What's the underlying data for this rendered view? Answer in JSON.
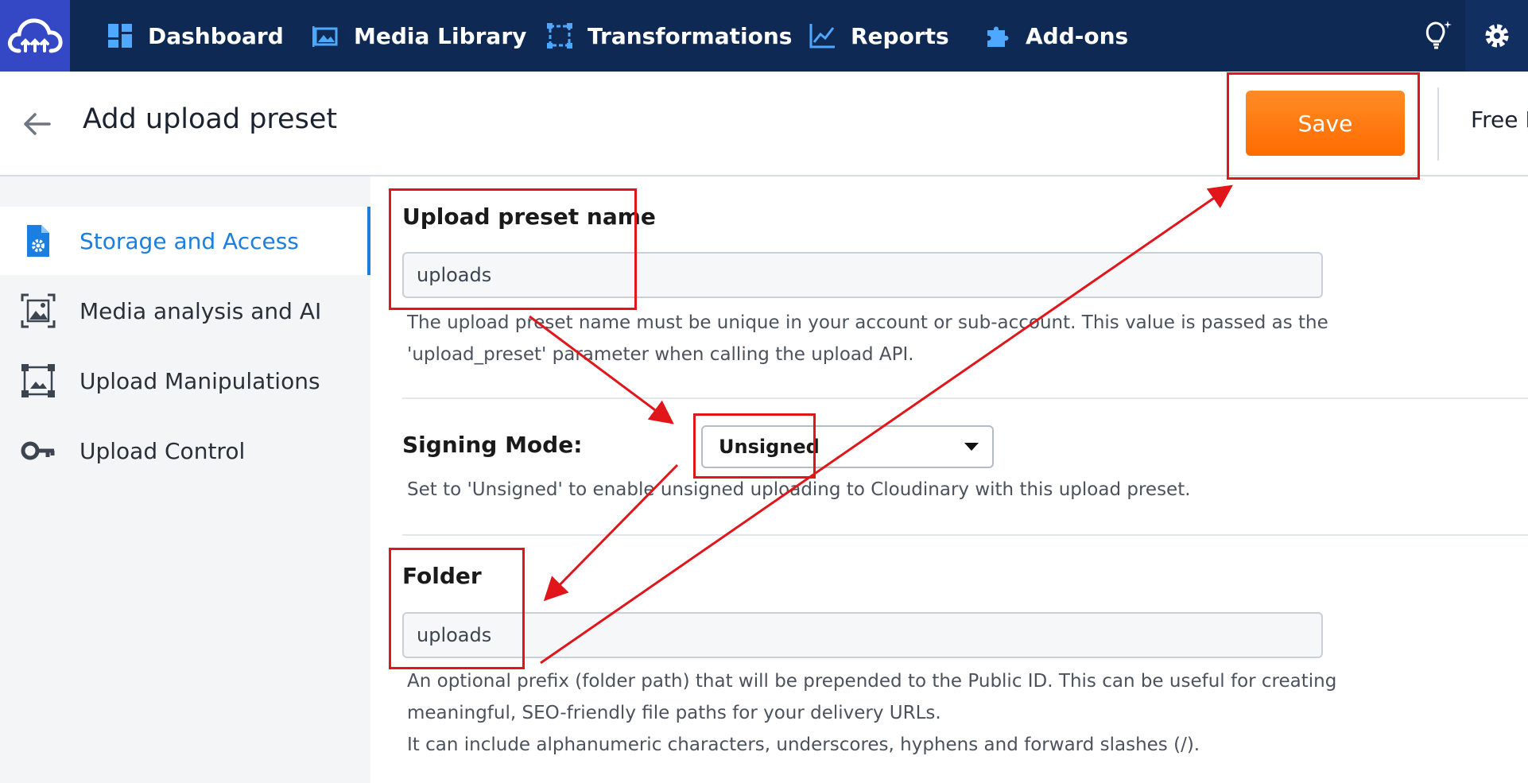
{
  "nav": {
    "items": [
      {
        "label": "Dashboard",
        "icon": "dashboard-icon"
      },
      {
        "label": "Media Library",
        "icon": "media-library-icon"
      },
      {
        "label": "Transformations",
        "icon": "transformations-icon"
      },
      {
        "label": "Reports",
        "icon": "reports-icon"
      },
      {
        "label": "Add-ons",
        "icon": "puzzle-icon"
      }
    ],
    "brand_color": "#0e2a54",
    "logo_color": "#3448c5"
  },
  "header": {
    "title": "Add upload preset",
    "save_label": "Save",
    "plan_label": "Free P"
  },
  "sidebar": {
    "items": [
      {
        "label": "Storage and Access",
        "icon": "file-settings-icon",
        "active": true
      },
      {
        "label": "Media analysis and AI",
        "icon": "image-analysis-icon",
        "active": false
      },
      {
        "label": "Upload Manipulations",
        "icon": "crop-image-icon",
        "active": false
      },
      {
        "label": "Upload Control",
        "icon": "key-icon",
        "active": false
      }
    ]
  },
  "form": {
    "preset_name": {
      "label": "Upload preset name",
      "value": "uploads",
      "help_line1": "The upload preset name must be unique in your account or sub-account. This value is passed as the",
      "help_line2": "'upload_preset' parameter when calling the upload API."
    },
    "signing_mode": {
      "label": "Signing Mode:",
      "value": "Unsigned",
      "help": "Set to 'Unsigned' to enable unsigned uploading to Cloudinary with this upload preset."
    },
    "folder": {
      "label": "Folder",
      "value": "uploads",
      "help_line1": "An optional prefix (folder path) that will be prepended to the Public ID. This can be useful for creating",
      "help_line2": "meaningful, SEO-friendly file paths for your delivery URLs.",
      "help_line3": "It can include alphanumeric characters, underscores, hyphens and forward slashes (/)."
    }
  },
  "colors": {
    "accent_blue": "#1a7fe0",
    "save_orange": "#ff7a12",
    "annotation_red": "#e0161b"
  }
}
